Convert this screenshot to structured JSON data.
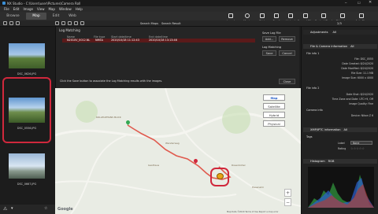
{
  "titlebar": {
    "title": "NX Studio - C:\\Users\\user\\Pictures\\Camera Roll"
  },
  "menu": [
    "File",
    "Edit",
    "Image",
    "View",
    "Map",
    "Window",
    "Help"
  ],
  "modes": [
    "Browse",
    "Map",
    "Edit",
    "Web"
  ],
  "toolbar_actions": [
    "Import",
    "Movie",
    "Print",
    "Email",
    "Upload",
    "Convert Files",
    "Contact Sheet",
    "Slide show",
    "Auto Play"
  ],
  "toolbar2": {
    "search_maps": "Search Maps",
    "search_result": "Search Result",
    "page_indicator": "2/3"
  },
  "thumbnails": [
    {
      "caption": "DSC_0626.JPG"
    },
    {
      "caption": "DSC_0556.JPG"
    },
    {
      "caption": "DSC_0667.JPG"
    }
  ],
  "log_panel": {
    "title": "Log Matching",
    "columns": [
      "Name",
      "File type",
      "Start date/time",
      "End date/time"
    ],
    "row": {
      "name": "N2010V_0012.NL",
      "type": "NMEA",
      "start": "2020/10/18 11:12:43",
      "end": "2020/10/18 13:13:46"
    },
    "log_file": "Save Log File",
    "add_label": "Add...",
    "remove_label": "Remove",
    "matching_label": "Log Matching",
    "save_label": "Save",
    "cancel_label": "Cancel",
    "hint": "Click the Save button to associate the Log Matching results with the images.",
    "close_label": "Close"
  },
  "map": {
    "buttons": [
      "Map",
      "Satellite",
      "Hybrid",
      "Physical"
    ],
    "selected": "Map",
    "zoom_in": "+",
    "zoom_out": "−",
    "google": "Google",
    "footer": "Map Data ©2020  Terms of Use  Report a map error",
    "places": [
      {
        "label": "KOLLEGEHANS BLICK"
      },
      {
        "label": "Wanderweg"
      },
      {
        "label": "Gasthaus"
      },
      {
        "label": "Rosenbühel"
      },
      {
        "label": "Hasenalm"
      }
    ],
    "colors": {
      "route": "#e05a4e",
      "start_marker": "#34a853",
      "photo_marker": "#e8a317",
      "highlight": "#d0283c"
    }
  },
  "right_panel": {
    "adjustments_label": "Adjustments",
    "adjustments_value": "All",
    "page": "2/3",
    "file_info_title": "File & Camera information",
    "file_info_value": "All",
    "file_info1_title": "File info 1",
    "file_info1": [
      {
        "label": "File",
        "value": "DSC_0555"
      },
      {
        "label": "Date Created",
        "value": "8/24/2020"
      },
      {
        "label": "Date Modified",
        "value": "8/24/2020"
      },
      {
        "label": "File Size",
        "value": "11.1 MB"
      },
      {
        "label": "Image Size",
        "value": "6000 x 4000"
      }
    ],
    "file_info2_title": "File info 2",
    "file_info2": [
      {
        "label": "Date Shot",
        "value": "8/24/2020"
      },
      {
        "label": "Time Zone and Date",
        "value": "UTC+9, Off"
      },
      {
        "label": "Image Quality",
        "value": "Fine"
      }
    ],
    "camera_info_title": "Camera info",
    "camera_info": [
      {
        "label": "Device",
        "value": "Nikon Z 6"
      }
    ],
    "xmp_title": "XMP/IPTC information",
    "xmp_value": "All",
    "tags_title": "Tags",
    "tags_label": "Label",
    "tags_value": "None",
    "rating_label": "Rating",
    "histogram_title": "Histogram",
    "histogram_value": "RGB"
  }
}
